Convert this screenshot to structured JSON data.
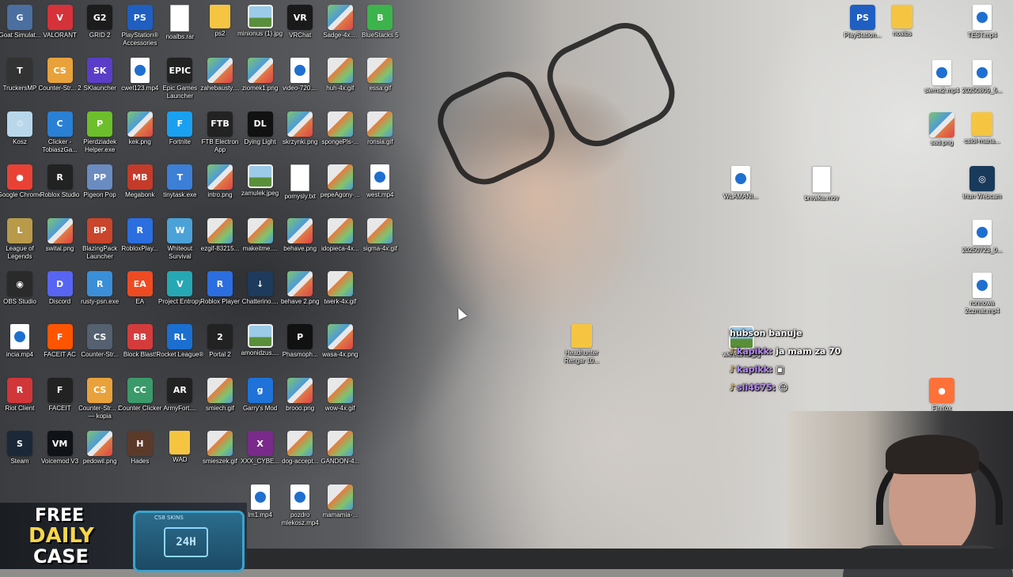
{
  "desktop": {
    "icons": [
      {
        "label": "Goat Simulat...",
        "type": "app",
        "color": "#4b6fa0",
        "glyph": "G",
        "col": 0,
        "row": 0
      },
      {
        "label": "VALORANT",
        "type": "app",
        "color": "#d6323a",
        "glyph": "V",
        "col": 1,
        "row": 0
      },
      {
        "label": "GRID 2",
        "type": "app",
        "color": "#1c1c1c",
        "glyph": "G2",
        "col": 2,
        "row": 0
      },
      {
        "label": "PlayStation® Accessories",
        "type": "app",
        "color": "#1f5fc1",
        "glyph": "PS",
        "col": 3,
        "row": 0
      },
      {
        "label": "noalbs.rar",
        "type": "file",
        "color": "#ffffff",
        "glyph": "",
        "col": 4,
        "row": 0
      },
      {
        "label": "ps2",
        "type": "folder",
        "color": "#f5c542",
        "glyph": "",
        "col": 5,
        "row": 0
      },
      {
        "label": "minionus (1).jpg",
        "type": "jpeg",
        "color": "#9ccbe8",
        "glyph": "",
        "col": 6,
        "row": 0
      },
      {
        "label": "VRChat",
        "type": "app",
        "color": "#1a1a1a",
        "glyph": "VR",
        "col": 7,
        "row": 0
      },
      {
        "label": "Sadge-4x....",
        "type": "image",
        "color": "#7ec46f",
        "glyph": "",
        "col": 8,
        "row": 0
      },
      {
        "label": "BlueStacks 5",
        "type": "app",
        "color": "#3cb44b",
        "glyph": "B",
        "col": 9,
        "row": 0
      },
      {
        "label": "TruckersMP",
        "type": "app",
        "color": "#333333",
        "glyph": "T",
        "col": 0,
        "row": 1
      },
      {
        "label": "Counter-Str... 2",
        "type": "app",
        "color": "#e9a23b",
        "glyph": "CS",
        "col": 1,
        "row": 1
      },
      {
        "label": "SKlauncher",
        "type": "app",
        "color": "#5a3ec8",
        "glyph": "SK",
        "col": 2,
        "row": 1
      },
      {
        "label": "cwel123.mp4",
        "type": "video",
        "color": "#ffffff",
        "glyph": "",
        "col": 3,
        "row": 1
      },
      {
        "label": "Epic Games Launcher",
        "type": "app",
        "color": "#222222",
        "glyph": "EPIC",
        "col": 4,
        "row": 1
      },
      {
        "label": "zahebausty....",
        "type": "image",
        "color": "#7ec46f",
        "glyph": "",
        "col": 5,
        "row": 1
      },
      {
        "label": "ziomek1.png",
        "type": "image",
        "color": "#7ec46f",
        "glyph": "",
        "col": 6,
        "row": 1
      },
      {
        "label": "video-720....",
        "type": "video",
        "color": "#ffffff",
        "glyph": "",
        "col": 7,
        "row": 1
      },
      {
        "label": "huh-4x.gif",
        "type": "gif",
        "color": "#e77b3b",
        "glyph": "",
        "col": 8,
        "row": 1
      },
      {
        "label": "essa.gif",
        "type": "gif",
        "color": "#e77b3b",
        "glyph": "",
        "col": 9,
        "row": 1
      },
      {
        "label": "Kosz",
        "type": "app",
        "color": "#b9d7ea",
        "glyph": "♲",
        "col": 0,
        "row": 2
      },
      {
        "label": "Clicker - TobiaszGa...",
        "type": "app",
        "color": "#2a80d4",
        "glyph": "C",
        "col": 1,
        "row": 2
      },
      {
        "label": "Pierdziadek Helper.exe",
        "type": "app",
        "color": "#6cbf2a",
        "glyph": "P",
        "col": 2,
        "row": 2
      },
      {
        "label": "kek.png",
        "type": "image",
        "color": "#7ec46f",
        "glyph": "",
        "col": 3,
        "row": 2
      },
      {
        "label": "Fortnite",
        "type": "app",
        "color": "#1aa0f0",
        "glyph": "F",
        "col": 4,
        "row": 2
      },
      {
        "label": "FTB Electron App",
        "type": "app",
        "color": "#222222",
        "glyph": "FTB",
        "col": 5,
        "row": 2
      },
      {
        "label": "Dying Light",
        "type": "app",
        "color": "#111111",
        "glyph": "DL",
        "col": 6,
        "row": 2
      },
      {
        "label": "skrzynki.png",
        "type": "image",
        "color": "#7ec46f",
        "glyph": "",
        "col": 7,
        "row": 2
      },
      {
        "label": "spongePls-...",
        "type": "gif",
        "color": "#e77b3b",
        "glyph": "",
        "col": 8,
        "row": 2
      },
      {
        "label": "ronsia.gif",
        "type": "gif",
        "color": "#e77b3b",
        "glyph": "",
        "col": 9,
        "row": 2
      },
      {
        "label": "Google Chrome",
        "type": "app",
        "color": "#e94235",
        "glyph": "●",
        "col": 0,
        "row": 3
      },
      {
        "label": "Roblox Studio",
        "type": "app",
        "color": "#222222",
        "glyph": "R",
        "col": 1,
        "row": 3
      },
      {
        "label": "Pigeon Pop",
        "type": "app",
        "color": "#6a8cc0",
        "glyph": "PP",
        "col": 2,
        "row": 3
      },
      {
        "label": "Megabonk",
        "type": "app",
        "color": "#c43b2a",
        "glyph": "MB",
        "col": 3,
        "row": 3
      },
      {
        "label": "tinytask.exe",
        "type": "app",
        "color": "#3c7fd6",
        "glyph": "T",
        "col": 4,
        "row": 3
      },
      {
        "label": "intro.png",
        "type": "image",
        "color": "#7ec46f",
        "glyph": "",
        "col": 5,
        "row": 3
      },
      {
        "label": "zamulek.jpeg",
        "type": "jpeg",
        "color": "#9ccbe8",
        "glyph": "",
        "col": 6,
        "row": 3
      },
      {
        "label": "pomysly.txt",
        "type": "file",
        "color": "#ffffff",
        "glyph": "",
        "col": 7,
        "row": 3
      },
      {
        "label": "pepeAgony-...",
        "type": "gif",
        "color": "#e77b3b",
        "glyph": "",
        "col": 8,
        "row": 3
      },
      {
        "label": "west.mp4",
        "type": "video",
        "color": "#ffffff",
        "glyph": "",
        "col": 9,
        "row": 3
      },
      {
        "label": "League of Legends",
        "type": "app",
        "color": "#b89a4a",
        "glyph": "L",
        "col": 0,
        "row": 4
      },
      {
        "label": "swital.png",
        "type": "image",
        "color": "#7ec46f",
        "glyph": "",
        "col": 1,
        "row": 4
      },
      {
        "label": "BlazingPack Launcher",
        "type": "app",
        "color": "#c9452b",
        "glyph": "BP",
        "col": 2,
        "row": 4
      },
      {
        "label": "RobloxPlay...",
        "type": "app",
        "color": "#2b6ee0",
        "glyph": "R",
        "col": 3,
        "row": 4
      },
      {
        "label": "Whiteout Survival",
        "type": "app",
        "color": "#4aa2d8",
        "glyph": "W",
        "col": 4,
        "row": 4
      },
      {
        "label": "ezgif-83215...",
        "type": "gif",
        "color": "#e77b3b",
        "glyph": "",
        "col": 5,
        "row": 4
      },
      {
        "label": "makeitme....",
        "type": "gif",
        "color": "#e77b3b",
        "glyph": "",
        "col": 6,
        "row": 4
      },
      {
        "label": "behave.png",
        "type": "image",
        "color": "#7ec46f",
        "glyph": "",
        "col": 7,
        "row": 4
      },
      {
        "label": "idopieca-4x...",
        "type": "gif",
        "color": "#e77b3b",
        "glyph": "",
        "col": 8,
        "row": 4
      },
      {
        "label": "sigma-4x.gif",
        "type": "gif",
        "color": "#e77b3b",
        "glyph": "",
        "col": 9,
        "row": 4
      },
      {
        "label": "OBS Studio",
        "type": "app",
        "color": "#2a2a2a",
        "glyph": "◉",
        "col": 0,
        "row": 5
      },
      {
        "label": "Discord",
        "type": "app",
        "color": "#5865f2",
        "glyph": "D",
        "col": 1,
        "row": 5
      },
      {
        "label": "rusty-psn.exe",
        "type": "app",
        "color": "#3a8fd8",
        "glyph": "R",
        "col": 2,
        "row": 5
      },
      {
        "label": "EA",
        "type": "app",
        "color": "#ef4b23",
        "glyph": "EA",
        "col": 3,
        "row": 5
      },
      {
        "label": "Project Entropy",
        "type": "app",
        "color": "#25a8b4",
        "glyph": "V",
        "col": 4,
        "row": 5
      },
      {
        "label": "Roblox Player",
        "type": "app",
        "color": "#2b6ee0",
        "glyph": "R",
        "col": 5,
        "row": 5
      },
      {
        "label": "Chatterino....",
        "type": "app",
        "color": "#1e3a5c",
        "glyph": "↓",
        "col": 6,
        "row": 5
      },
      {
        "label": "behave 2.png",
        "type": "image",
        "color": "#7ec46f",
        "glyph": "",
        "col": 7,
        "row": 5
      },
      {
        "label": "twerk-4x.gif",
        "type": "gif",
        "color": "#e77b3b",
        "glyph": "",
        "col": 8,
        "row": 5
      },
      {
        "label": "incia.mp4",
        "type": "video",
        "color": "#ffffff",
        "glyph": "",
        "col": 0,
        "row": 6
      },
      {
        "label": "FACEIT AC",
        "type": "app",
        "color": "#ff5500",
        "glyph": "F",
        "col": 1,
        "row": 6
      },
      {
        "label": "Counter-Str...",
        "type": "app",
        "color": "#556070",
        "glyph": "CS",
        "col": 2,
        "row": 6
      },
      {
        "label": "Block Blast!",
        "type": "app",
        "color": "#d43c3c",
        "glyph": "BB",
        "col": 3,
        "row": 6
      },
      {
        "label": "Rocket League®",
        "type": "app",
        "color": "#1b6fd1",
        "glyph": "RL",
        "col": 4,
        "row": 6
      },
      {
        "label": "Portal 2",
        "type": "app",
        "color": "#222222",
        "glyph": "2",
        "col": 5,
        "row": 6
      },
      {
        "label": "amonidzus....",
        "type": "jpeg",
        "color": "#9ccbe8",
        "glyph": "",
        "col": 6,
        "row": 6
      },
      {
        "label": "Phasmoph...",
        "type": "app",
        "color": "#111111",
        "glyph": "P",
        "col": 7,
        "row": 6
      },
      {
        "label": "wasa-4x.png",
        "type": "image",
        "color": "#7ec46f",
        "glyph": "",
        "col": 8,
        "row": 6
      },
      {
        "label": "Riot Client",
        "type": "app",
        "color": "#d13639",
        "glyph": "R",
        "col": 0,
        "row": 7
      },
      {
        "label": "FACEIT",
        "type": "app",
        "color": "#222222",
        "glyph": "F",
        "col": 1,
        "row": 7
      },
      {
        "label": "Counter-Str... 2 — kopia",
        "type": "app",
        "color": "#e9a23b",
        "glyph": "CS",
        "col": 2,
        "row": 7
      },
      {
        "label": "Counter Clicker",
        "type": "app",
        "color": "#3b9a6a",
        "glyph": "CC",
        "col": 3,
        "row": 7
      },
      {
        "label": "ArmyFort....",
        "type": "app",
        "color": "#222222",
        "glyph": "AR",
        "col": 4,
        "row": 7
      },
      {
        "label": "smiech.gif",
        "type": "gif",
        "color": "#e77b3b",
        "glyph": "",
        "col": 5,
        "row": 7
      },
      {
        "label": "Garry's Mod",
        "type": "app",
        "color": "#1f72d8",
        "glyph": "g",
        "col": 6,
        "row": 7
      },
      {
        "label": "brooo.png",
        "type": "image",
        "color": "#7ec46f",
        "glyph": "",
        "col": 7,
        "row": 7
      },
      {
        "label": "wow-4x.gif",
        "type": "gif",
        "color": "#e77b3b",
        "glyph": "",
        "col": 8,
        "row": 7
      },
      {
        "label": "Steam",
        "type": "app",
        "color": "#1b2838",
        "glyph": "S",
        "col": 0,
        "row": 8
      },
      {
        "label": "Voicemod V3",
        "type": "app",
        "color": "#0f1216",
        "glyph": "VM",
        "col": 1,
        "row": 8
      },
      {
        "label": "pedowil.png",
        "type": "image",
        "color": "#7ec46f",
        "glyph": "",
        "col": 2,
        "row": 8
      },
      {
        "label": "Hades",
        "type": "app",
        "color": "#5c3a2a",
        "glyph": "H",
        "col": 3,
        "row": 8
      },
      {
        "label": "WAD",
        "type": "folder",
        "color": "#f5c542",
        "glyph": "",
        "col": 4,
        "row": 8
      },
      {
        "label": "smieszek.gif",
        "type": "gif",
        "color": "#e77b3b",
        "glyph": "",
        "col": 5,
        "row": 8
      },
      {
        "label": "XXX_CYBE...",
        "type": "app",
        "color": "#7a2a8a",
        "glyph": "X",
        "col": 6,
        "row": 8
      },
      {
        "label": "dog-accept...",
        "type": "gif",
        "color": "#e77b3b",
        "glyph": "",
        "col": 7,
        "row": 8
      },
      {
        "label": "GANDON-4...",
        "type": "gif",
        "color": "#e77b3b",
        "glyph": "",
        "col": 8,
        "row": 8
      },
      {
        "label": "lm1.mp4",
        "type": "video",
        "color": "#ffffff",
        "glyph": "",
        "col": 6,
        "row": 9
      },
      {
        "label": "pozdro mlekosz.mp4",
        "type": "video",
        "color": "#ffffff",
        "glyph": "",
        "col": 7,
        "row": 9
      },
      {
        "label": "mamamia-...",
        "type": "gif",
        "color": "#e77b3b",
        "glyph": "",
        "col": 8,
        "row": 9
      }
    ],
    "right_icons": [
      {
        "label": "PlayStation...",
        "type": "app",
        "color": "#1f5fc1",
        "glyph": "PS",
        "slot": "r1c0"
      },
      {
        "label": "noalbs",
        "type": "folder",
        "color": "#f5c542",
        "glyph": "",
        "slot": "r1c1"
      },
      {
        "label": "TEST.mp4",
        "type": "video",
        "color": "#ffffff",
        "glyph": "",
        "slot": "r1c3"
      },
      {
        "label": "sierna2.mp4",
        "type": "video",
        "color": "#ffffff",
        "glyph": "",
        "slot": "r2c2"
      },
      {
        "label": "20250809_5...",
        "type": "video",
        "color": "#ffffff",
        "glyph": "",
        "slot": "r2c3"
      },
      {
        "label": "sad.png",
        "type": "image",
        "color": "#7ec46f",
        "glyph": "",
        "slot": "r3c2"
      },
      {
        "label": "cslol-mana...",
        "type": "folder",
        "color": "#f5c542",
        "glyph": "",
        "slot": "r3c3"
      },
      {
        "label": "WLAMANI...",
        "type": "video",
        "color": "#ffffff",
        "glyph": "",
        "slot": "r4a"
      },
      {
        "label": "brewka.mov",
        "type": "file",
        "color": "#ffffff",
        "glyph": "",
        "slot": "r4b"
      },
      {
        "label": "Iriun Webcam",
        "type": "app",
        "color": "#1a3a5c",
        "glyph": "◎",
        "slot": "r4c3"
      },
      {
        "label": "20250723_0...",
        "type": "video",
        "color": "#ffffff",
        "glyph": "",
        "slot": "r5c3"
      },
      {
        "label": "ronnowa 2czmat.mp4",
        "type": "video",
        "color": "#ffffff",
        "glyph": "",
        "slot": "r6c3"
      },
      {
        "label": "Headhunter Rengar 10...",
        "type": "folder",
        "color": "#f5c542",
        "glyph": "",
        "slot": "mid"
      },
      {
        "label": "wkretarka.jpg",
        "type": "jpeg",
        "color": "#9ccbe8",
        "glyph": "",
        "slot": "chat"
      },
      {
        "label": "Firefox",
        "type": "app",
        "color": "#ff7139",
        "glyph": "●",
        "slot": "fox"
      }
    ]
  },
  "chat": {
    "messages": [
      {
        "user": "",
        "text": "hubson banuje"
      },
      {
        "user": "kapikk:",
        "text": "ja mam za 70"
      },
      {
        "user": "kapikk:",
        "text": "▣"
      },
      {
        "user": "sli4675:",
        "text": "☺"
      }
    ]
  },
  "promo": {
    "line1": "FREE",
    "line2": "DAILY",
    "line3": "CASE",
    "crate_top": "CS8 SKINS",
    "crate_label": "24H"
  }
}
